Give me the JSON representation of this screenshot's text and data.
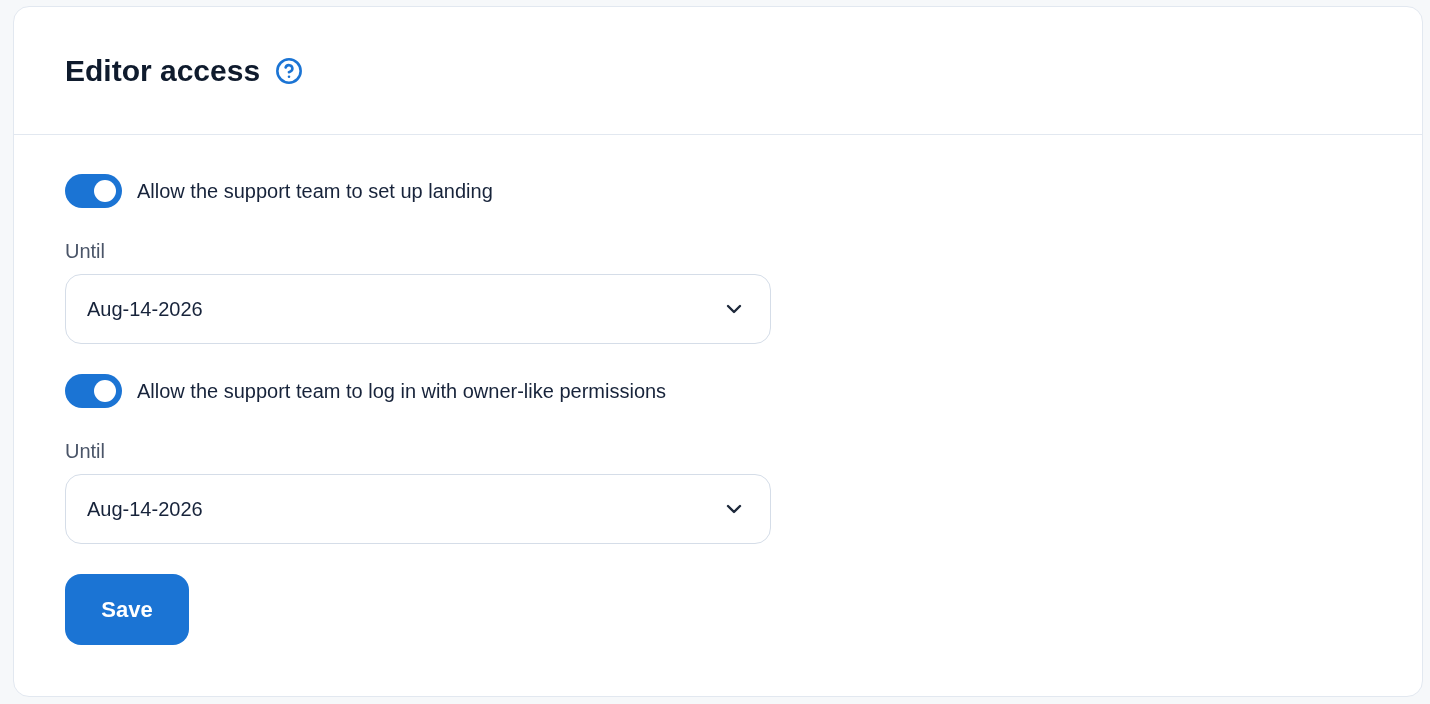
{
  "header": {
    "title": "Editor access"
  },
  "settings": [
    {
      "label": "Allow the support team to set up landing",
      "on": true,
      "until": {
        "label": "Until",
        "value": "Aug-14-2026"
      }
    },
    {
      "label": "Allow the support team to log in with owner-like permissions",
      "on": true,
      "until": {
        "label": "Until",
        "value": "Aug-14-2026"
      }
    }
  ],
  "save_button": {
    "label": "Save"
  }
}
